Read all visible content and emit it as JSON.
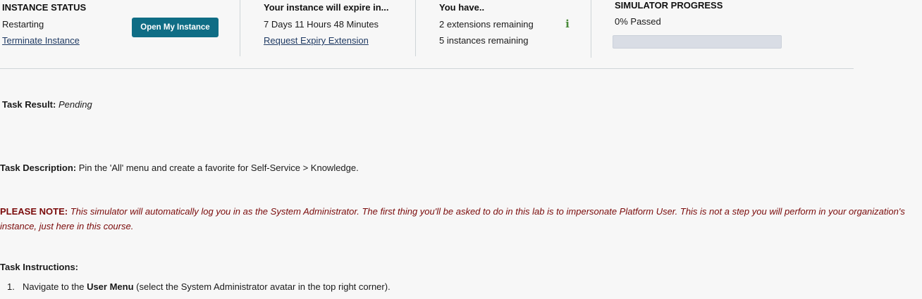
{
  "instance": {
    "header": "INSTANCE STATUS",
    "status": "Restarting",
    "terminate_link": "Terminate Instance",
    "open_button": "Open My Instance"
  },
  "expiry": {
    "header": "Your instance will expire in...",
    "time_left": "7 Days 11 Hours 48 Minutes",
    "request_link": "Request Expiry Extension"
  },
  "quota": {
    "header": "You have..",
    "extensions": "2 extensions remaining",
    "instances": "5 instances remaining",
    "info_icon": "info-icon"
  },
  "progress": {
    "header": "SIMULATOR PROGRESS",
    "passed_text": "0% Passed",
    "percent": 0,
    "fill_color": "#0f6d85"
  },
  "task": {
    "result_label": "Task Result:",
    "result_value": "Pending",
    "description_label": "Task Description:",
    "description_value": "Pin the 'All' menu and create a favorite for Self-Service > Knowledge.",
    "note_label": "PLEASE NOTE:",
    "note_value": "This simulator will automatically log you in as the System Administrator. The first thing you'll be asked to do in this lab is to impersonate Platform User. This is not a step you will perform in your organization's instance, just here in this course.",
    "instructions_label": "Task Instructions:",
    "steps": [
      {
        "num": "1.",
        "prefix": "Navigate to the ",
        "bold": "User Menu",
        "suffix": " (select the System Administrator avatar in the top right corner)."
      }
    ]
  },
  "colors": {
    "button_bg": "#0f6d85",
    "note_color": "#7a0a0a",
    "link_color": "#1f3a63",
    "info_icon_color": "#4a8a3a"
  }
}
